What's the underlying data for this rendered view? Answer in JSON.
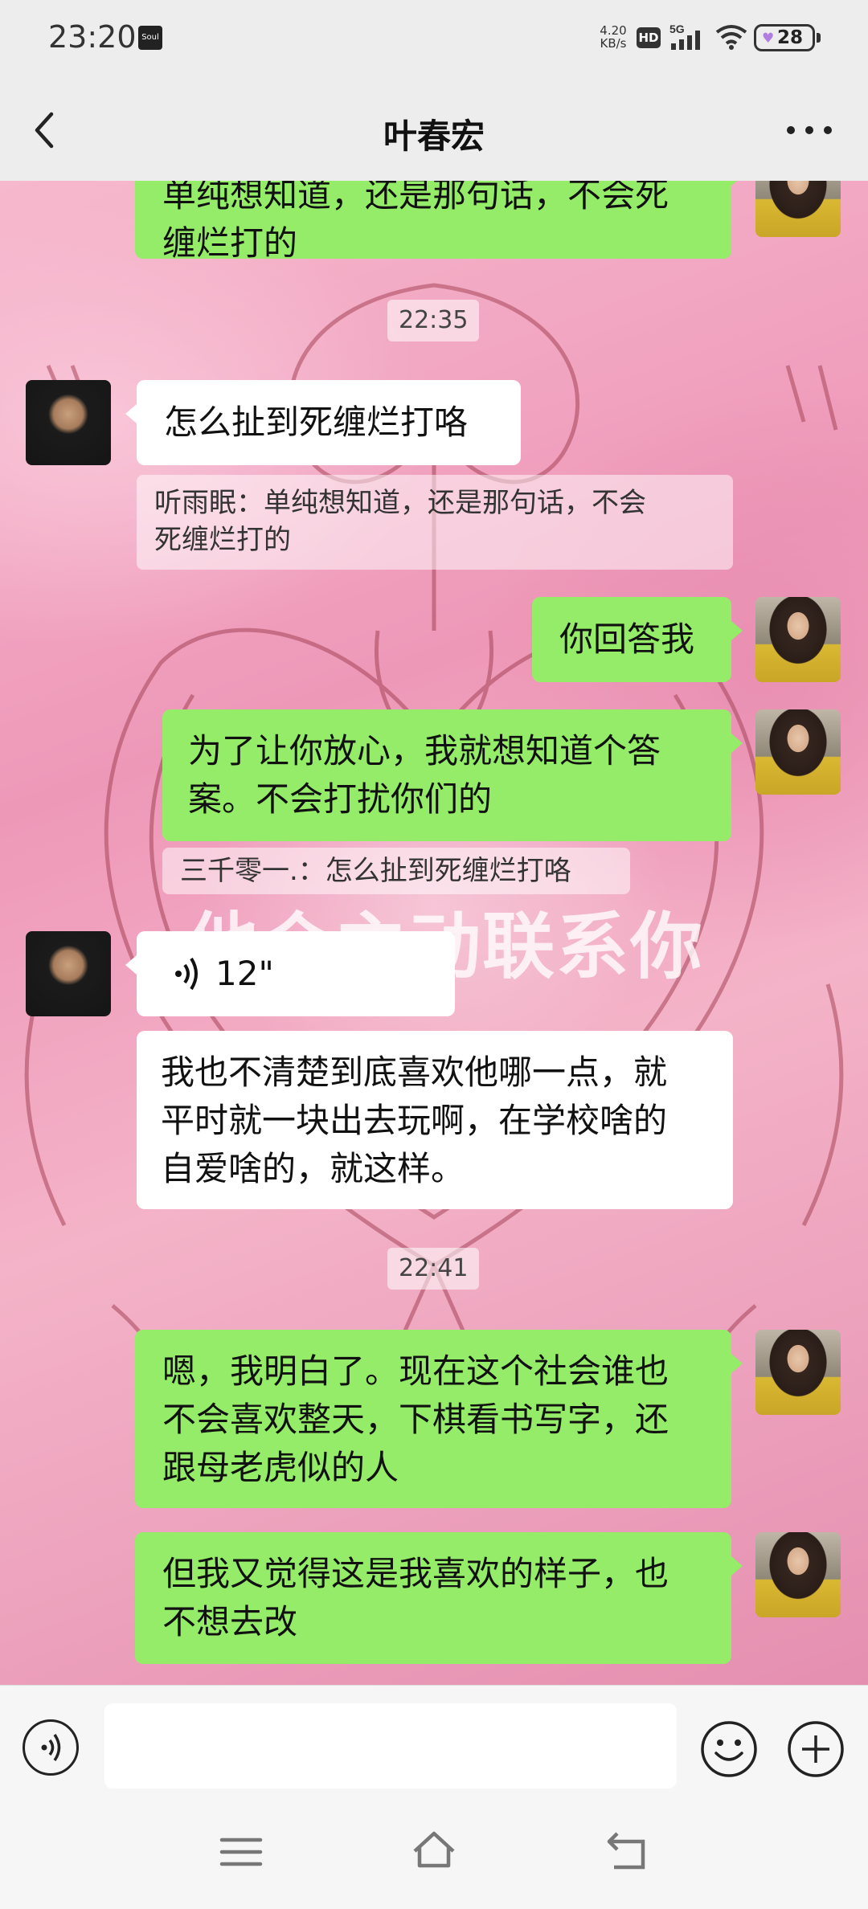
{
  "status_bar": {
    "time": "23:20",
    "app_icon": "Soul",
    "net_speed_value": "4.20",
    "net_speed_unit": "KB/s",
    "hd": "HD",
    "network": "5G",
    "battery": "28"
  },
  "header": {
    "title": "叶春宏"
  },
  "chat": {
    "watermark": "他会主动联系你",
    "messages": [
      {
        "id": "m1",
        "side": "right",
        "text_line1": "单纯想知道，还是那句话，不会死",
        "text_line2": "缠烂打的"
      },
      {
        "id": "t1",
        "type": "timestamp",
        "text": "22:35"
      },
      {
        "id": "m2",
        "side": "left",
        "text": "怎么扯到死缠烂打咯"
      },
      {
        "id": "q1",
        "type": "quote",
        "text_line1": "听雨眠：单纯想知道，还是那句话，不会",
        "text_line2": "死缠烂打的"
      },
      {
        "id": "m3",
        "side": "right",
        "text": "你回答我"
      },
      {
        "id": "m4",
        "side": "right",
        "text_line1": "为了让你放心，我就想知道个答",
        "text_line2": "案。不会打扰你们的"
      },
      {
        "id": "q2",
        "type": "quote",
        "text": "三千零一.：怎么扯到死缠烂打咯"
      },
      {
        "id": "m5",
        "side": "left",
        "type": "voice",
        "duration": "12\""
      },
      {
        "id": "m6",
        "side": "left",
        "text_line1": "我也不清楚到底喜欢他哪一点，就",
        "text_line2": "平时就一块出去玩啊，在学校啥的",
        "text_line3": "自爱啥的，就这样。"
      },
      {
        "id": "t2",
        "type": "timestamp",
        "text": "22:41"
      },
      {
        "id": "m7",
        "side": "right",
        "text_line1": "嗯，我明白了。现在这个社会谁也",
        "text_line2": "不会喜欢整天，下棋看书写字，还",
        "text_line3": "跟母老虎似的人"
      },
      {
        "id": "m8",
        "side": "right",
        "text_line1": "但我又觉得这是我喜欢的样子，也",
        "text_line2": "不想去改"
      }
    ]
  },
  "input_bar": {
    "placeholder": ""
  },
  "colors": {
    "sent_bubble": "#95ec69",
    "received_bubble": "#ffffff",
    "header_bg": "#ededed"
  }
}
